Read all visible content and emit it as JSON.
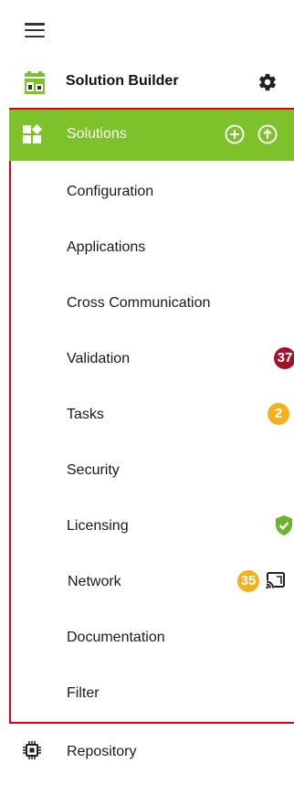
{
  "app": {
    "title": "Solution Builder"
  },
  "nav": {
    "solutions_label": "Solutions",
    "items": [
      {
        "label": "Configuration"
      },
      {
        "label": "Applications"
      },
      {
        "label": "Cross Communication"
      },
      {
        "label": "Validation",
        "badge": "37"
      },
      {
        "label": "Tasks",
        "badge": "2"
      },
      {
        "label": "Security"
      },
      {
        "label": "Licensing"
      },
      {
        "label": "Network",
        "badge": "35"
      },
      {
        "label": "Documentation"
      },
      {
        "label": "Filter"
      }
    ]
  },
  "repository": {
    "label": "Repository"
  },
  "icons": {
    "menu": "hamburger-menu-icon",
    "logo": "solution-builder-logo-icon",
    "settings": "gear-icon",
    "solutions": "solutions-grid-icon",
    "add": "plus-circle-icon",
    "upload": "arrow-up-circle-icon",
    "licensing": "shield-check-icon",
    "network": "cast-icon",
    "repository": "chip-icon"
  },
  "colors": {
    "accent": "#7dc12b",
    "frame": "#e3000f",
    "badge_red": "#a3142b",
    "badge_yellow": "#f2b21c",
    "shield": "#6ab42d"
  }
}
